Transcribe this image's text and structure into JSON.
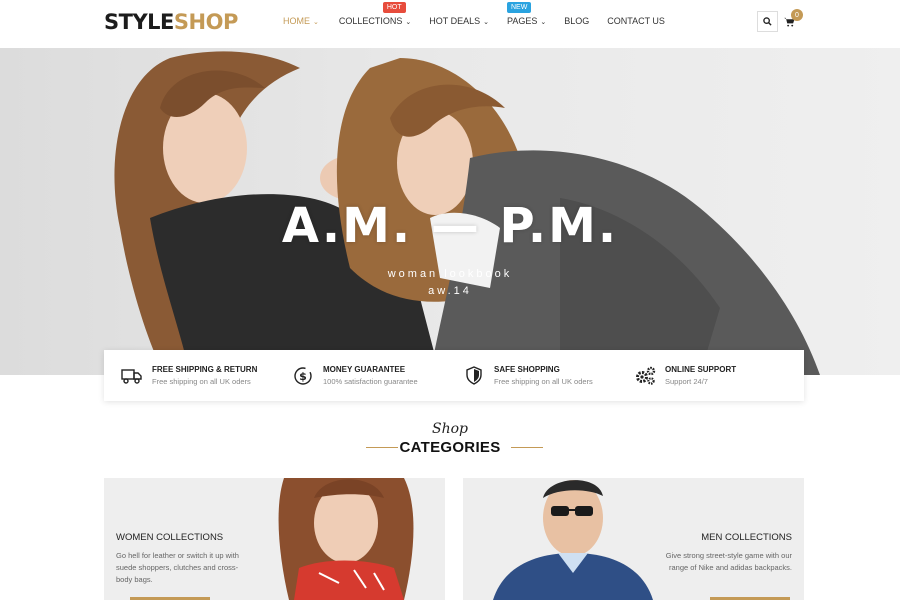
{
  "brand": {
    "part1": "STYLE",
    "part2": "SHOP"
  },
  "nav": [
    {
      "label": "HOME",
      "active": true
    },
    {
      "label": "COLLECTIONS",
      "badge": "Hot"
    },
    {
      "label": "HOT DEALS"
    },
    {
      "label": "PAGES",
      "badge": "New"
    },
    {
      "label": "BLOG"
    },
    {
      "label": "CONTACT US"
    }
  ],
  "header": {
    "search_icon": "search-icon",
    "cart_icon": "cart-icon",
    "cart_count": "0"
  },
  "hero": {
    "title": "A.M. — P.M.",
    "subtitle1": "woman lookbook",
    "subtitle2": "aw.14"
  },
  "features": [
    {
      "icon": "truck-icon",
      "title": "FREE SHIPPING & RETURN",
      "desc": "Free shipping on all UK oders"
    },
    {
      "icon": "money-icon",
      "title": "MONEY GUARANTEE",
      "desc": "100% satisfaction guarantee"
    },
    {
      "icon": "shield-icon",
      "title": "SAFE SHOPPING",
      "desc": "Free shipping on all UK oders"
    },
    {
      "icon": "gears-icon",
      "title": "ONLINE SUPPORT",
      "desc": "Support 24/7"
    }
  ],
  "categories": {
    "script": "Shop",
    "heading": "CATEGORIES",
    "items": [
      {
        "title": "WOMEN COLLECTIONS",
        "desc": "Go hell for leather or switch it up with suede shoppers, clutches and cross-body bags."
      },
      {
        "title": "MEN COLLECTIONS",
        "desc": "Give strong street-style game with our range of Nike and adidas backpacks."
      }
    ]
  },
  "colors": {
    "accent": "#c49a56",
    "hot": "#e74c3c",
    "new": "#2aa3e0"
  }
}
